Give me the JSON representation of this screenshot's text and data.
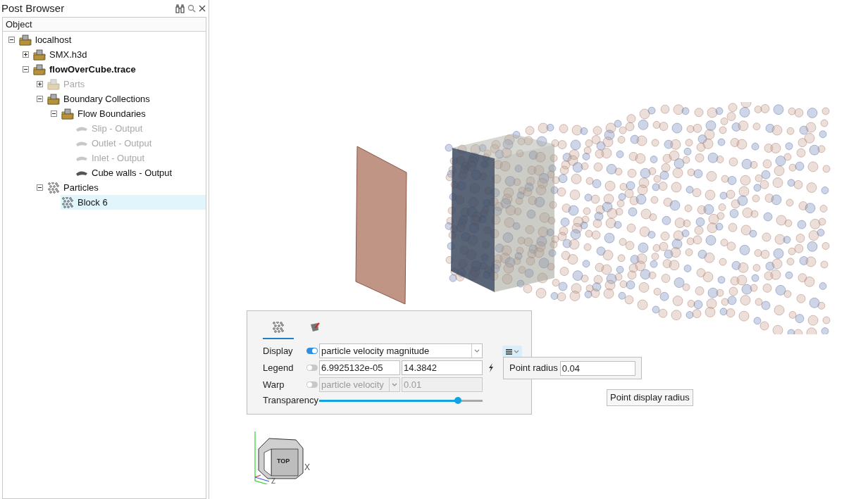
{
  "browser": {
    "title": "Post Browser",
    "column": "Object",
    "tree": [
      {
        "label": "localhost",
        "kind": "folder",
        "expanded": true,
        "disabled": false,
        "bold": false,
        "selected": false,
        "children": [
          {
            "label": "SMX.h3d",
            "kind": "folder",
            "expanded": false,
            "disabled": false,
            "bold": false,
            "selected": false
          },
          {
            "label": "flowOverCube.trace",
            "kind": "folder",
            "expanded": true,
            "disabled": false,
            "bold": true,
            "selected": false,
            "children": [
              {
                "label": "Parts",
                "kind": "folder",
                "expanded": false,
                "disabled": true,
                "bold": false,
                "selected": false
              },
              {
                "label": "Boundary Collections",
                "kind": "folder",
                "expanded": true,
                "disabled": false,
                "bold": false,
                "selected": false,
                "children": [
                  {
                    "label": "Flow Boundaries",
                    "kind": "folder",
                    "expanded": true,
                    "disabled": false,
                    "bold": false,
                    "selected": false,
                    "children": [
                      {
                        "label": "Slip - Output",
                        "kind": "surface",
                        "disabled": true,
                        "bold": false,
                        "selected": false
                      },
                      {
                        "label": "Outlet - Output",
                        "kind": "surface",
                        "disabled": true,
                        "bold": false,
                        "selected": false
                      },
                      {
                        "label": "Inlet - Output",
                        "kind": "surface",
                        "disabled": true,
                        "bold": false,
                        "selected": false
                      },
                      {
                        "label": "Cube walls - Output",
                        "kind": "surface",
                        "disabled": false,
                        "bold": false,
                        "selected": false
                      }
                    ]
                  }
                ]
              },
              {
                "label": "Particles",
                "kind": "particles",
                "expanded": true,
                "disabled": false,
                "bold": false,
                "selected": false,
                "children": [
                  {
                    "label": "Block 6",
                    "kind": "particles",
                    "disabled": false,
                    "bold": false,
                    "selected": true
                  }
                ]
              }
            ]
          }
        ]
      }
    ]
  },
  "panel": {
    "tabs": [
      {
        "kind": "particles",
        "selected": true
      },
      {
        "kind": "paint",
        "selected": false
      }
    ],
    "display": {
      "label": "Display",
      "on": true,
      "value": "particle velocity magnitude"
    },
    "legend": {
      "label": "Legend",
      "on": false,
      "min": "6.9925132e-05",
      "max": "14.3842"
    },
    "warp": {
      "label": "Warp",
      "on": false,
      "disabled": true,
      "value": "particle velocity",
      "scale": "0.01"
    },
    "transparency": {
      "label": "Transparency",
      "level": 0.85
    }
  },
  "popup": {
    "label": "Point radius",
    "value": "0.04"
  },
  "tooltip": "Point display radius",
  "axes": {
    "cube_face": "TOP",
    "x": "X",
    "z": "Z"
  }
}
